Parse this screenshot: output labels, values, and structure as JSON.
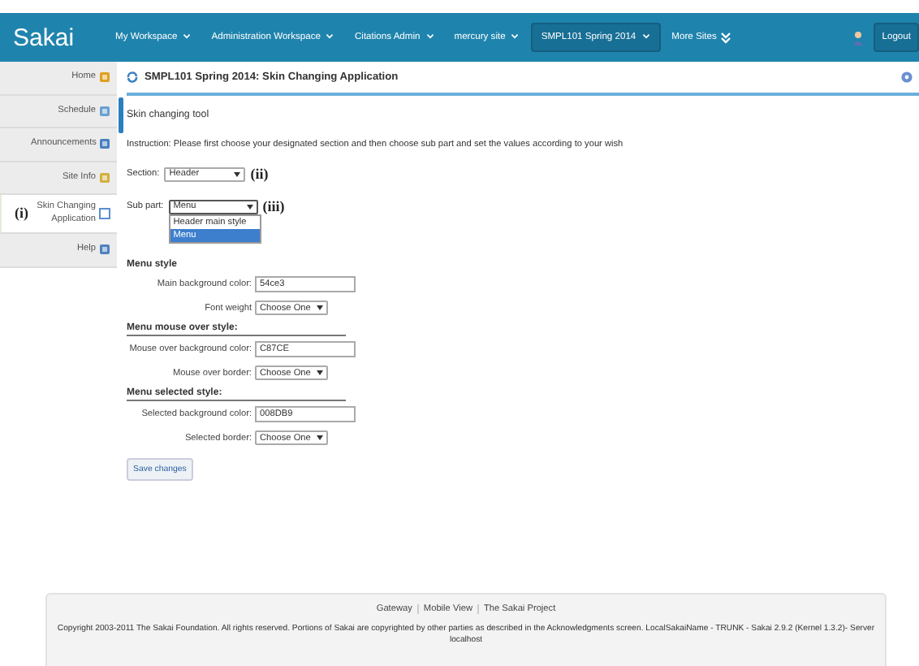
{
  "header": {
    "logo": "Sakai",
    "logout": "Logout",
    "nav": [
      {
        "label": "My Workspace",
        "selected": false
      },
      {
        "label": "Administration Workspace",
        "selected": false
      },
      {
        "label": "Citations Admin",
        "selected": false
      },
      {
        "label": "mercury site",
        "selected": false
      },
      {
        "label": "SMPL101 Spring 2014",
        "selected": true
      },
      {
        "label": "More Sites",
        "selected": false
      }
    ]
  },
  "sidebar": {
    "items": [
      {
        "label": "Home",
        "selected": false
      },
      {
        "label": "Schedule",
        "selected": false
      },
      {
        "label": "Announcements",
        "selected": false
      },
      {
        "label": "Site Info",
        "selected": false
      },
      {
        "label": "Skin Changing Application",
        "selected": true,
        "annotation": "(i)"
      },
      {
        "label": "Help",
        "selected": false
      }
    ]
  },
  "page": {
    "title": "SMPL101 Spring 2014: Skin Changing Application",
    "tool_title": "Skin changing tool",
    "instruction": "Instruction: Please first choose your designated section and then choose sub part and set the values according to your wish",
    "section": {
      "label": "Section:",
      "value": "Header",
      "annotation": "(ii)"
    },
    "sub_part": {
      "label": "Sub part:",
      "value": "Menu",
      "annotation": "(iii)",
      "options": [
        {
          "label": "Header main style",
          "selected": false
        },
        {
          "label": "Menu",
          "selected": true
        }
      ]
    },
    "groups": [
      {
        "heading": "Menu style",
        "ruled": false,
        "fields": [
          {
            "kind": "text",
            "label": "Main background color:",
            "value": "54ce3"
          },
          {
            "kind": "select",
            "label": "Font weight",
            "value": "Choose One"
          }
        ]
      },
      {
        "heading": "Menu mouse over style:",
        "ruled": true,
        "fields": [
          {
            "kind": "text",
            "label": "Mouse over background color:",
            "value": "C87CE"
          },
          {
            "kind": "select",
            "label": "Mouse over border:",
            "value": "Choose One"
          }
        ]
      },
      {
        "heading": "Menu selected style:",
        "ruled": true,
        "fields": [
          {
            "kind": "text",
            "label": "Selected background color:",
            "value": "008DB9"
          },
          {
            "kind": "select",
            "label": "Selected border:",
            "value": "Choose One"
          }
        ]
      }
    ],
    "save": "Save changes"
  },
  "footer": {
    "links": [
      "Gateway",
      "Mobile View",
      "The Sakai Project"
    ],
    "copyright": "Copyright 2003-2011 The Sakai Foundation. All rights reserved. Portions of Sakai are copyrighted by other parties as described in the Acknowledgments screen. LocalSakaiName - TRUNK - Sakai 2.9.2 (Kernel 1.3.2)- Server localhost"
  }
}
